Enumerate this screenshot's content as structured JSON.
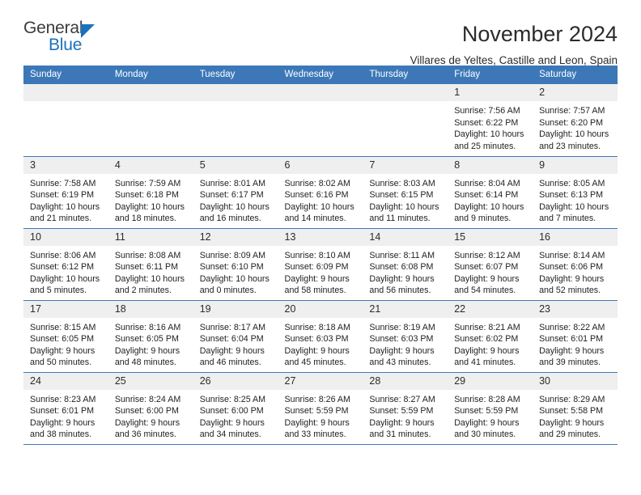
{
  "brand": {
    "name_part1": "General",
    "name_part2": "Blue",
    "triangle_color": "#1a72bd"
  },
  "header": {
    "month_title": "November 2024",
    "location": "Villares de Yeltes, Castille and Leon, Spain"
  },
  "theme": {
    "header_blue": "#3c78b8",
    "daynum_gray": "#efefef"
  },
  "calendar": {
    "weekday_headers": [
      "Sunday",
      "Monday",
      "Tuesday",
      "Wednesday",
      "Thursday",
      "Friday",
      "Saturday"
    ],
    "weeks": [
      [
        {
          "day": "",
          "empty": true
        },
        {
          "day": "",
          "empty": true
        },
        {
          "day": "",
          "empty": true
        },
        {
          "day": "",
          "empty": true
        },
        {
          "day": "",
          "empty": true
        },
        {
          "day": "1",
          "sunrise": "Sunrise: 7:56 AM",
          "sunset": "Sunset: 6:22 PM",
          "daylight1": "Daylight: 10 hours",
          "daylight2": "and 25 minutes."
        },
        {
          "day": "2",
          "sunrise": "Sunrise: 7:57 AM",
          "sunset": "Sunset: 6:20 PM",
          "daylight1": "Daylight: 10 hours",
          "daylight2": "and 23 minutes."
        }
      ],
      [
        {
          "day": "3",
          "sunrise": "Sunrise: 7:58 AM",
          "sunset": "Sunset: 6:19 PM",
          "daylight1": "Daylight: 10 hours",
          "daylight2": "and 21 minutes."
        },
        {
          "day": "4",
          "sunrise": "Sunrise: 7:59 AM",
          "sunset": "Sunset: 6:18 PM",
          "daylight1": "Daylight: 10 hours",
          "daylight2": "and 18 minutes."
        },
        {
          "day": "5",
          "sunrise": "Sunrise: 8:01 AM",
          "sunset": "Sunset: 6:17 PM",
          "daylight1": "Daylight: 10 hours",
          "daylight2": "and 16 minutes."
        },
        {
          "day": "6",
          "sunrise": "Sunrise: 8:02 AM",
          "sunset": "Sunset: 6:16 PM",
          "daylight1": "Daylight: 10 hours",
          "daylight2": "and 14 minutes."
        },
        {
          "day": "7",
          "sunrise": "Sunrise: 8:03 AM",
          "sunset": "Sunset: 6:15 PM",
          "daylight1": "Daylight: 10 hours",
          "daylight2": "and 11 minutes."
        },
        {
          "day": "8",
          "sunrise": "Sunrise: 8:04 AM",
          "sunset": "Sunset: 6:14 PM",
          "daylight1": "Daylight: 10 hours",
          "daylight2": "and 9 minutes."
        },
        {
          "day": "9",
          "sunrise": "Sunrise: 8:05 AM",
          "sunset": "Sunset: 6:13 PM",
          "daylight1": "Daylight: 10 hours",
          "daylight2": "and 7 minutes."
        }
      ],
      [
        {
          "day": "10",
          "sunrise": "Sunrise: 8:06 AM",
          "sunset": "Sunset: 6:12 PM",
          "daylight1": "Daylight: 10 hours",
          "daylight2": "and 5 minutes."
        },
        {
          "day": "11",
          "sunrise": "Sunrise: 8:08 AM",
          "sunset": "Sunset: 6:11 PM",
          "daylight1": "Daylight: 10 hours",
          "daylight2": "and 2 minutes."
        },
        {
          "day": "12",
          "sunrise": "Sunrise: 8:09 AM",
          "sunset": "Sunset: 6:10 PM",
          "daylight1": "Daylight: 10 hours",
          "daylight2": "and 0 minutes."
        },
        {
          "day": "13",
          "sunrise": "Sunrise: 8:10 AM",
          "sunset": "Sunset: 6:09 PM",
          "daylight1": "Daylight: 9 hours",
          "daylight2": "and 58 minutes."
        },
        {
          "day": "14",
          "sunrise": "Sunrise: 8:11 AM",
          "sunset": "Sunset: 6:08 PM",
          "daylight1": "Daylight: 9 hours",
          "daylight2": "and 56 minutes."
        },
        {
          "day": "15",
          "sunrise": "Sunrise: 8:12 AM",
          "sunset": "Sunset: 6:07 PM",
          "daylight1": "Daylight: 9 hours",
          "daylight2": "and 54 minutes."
        },
        {
          "day": "16",
          "sunrise": "Sunrise: 8:14 AM",
          "sunset": "Sunset: 6:06 PM",
          "daylight1": "Daylight: 9 hours",
          "daylight2": "and 52 minutes."
        }
      ],
      [
        {
          "day": "17",
          "sunrise": "Sunrise: 8:15 AM",
          "sunset": "Sunset: 6:05 PM",
          "daylight1": "Daylight: 9 hours",
          "daylight2": "and 50 minutes."
        },
        {
          "day": "18",
          "sunrise": "Sunrise: 8:16 AM",
          "sunset": "Sunset: 6:05 PM",
          "daylight1": "Daylight: 9 hours",
          "daylight2": "and 48 minutes."
        },
        {
          "day": "19",
          "sunrise": "Sunrise: 8:17 AM",
          "sunset": "Sunset: 6:04 PM",
          "daylight1": "Daylight: 9 hours",
          "daylight2": "and 46 minutes."
        },
        {
          "day": "20",
          "sunrise": "Sunrise: 8:18 AM",
          "sunset": "Sunset: 6:03 PM",
          "daylight1": "Daylight: 9 hours",
          "daylight2": "and 45 minutes."
        },
        {
          "day": "21",
          "sunrise": "Sunrise: 8:19 AM",
          "sunset": "Sunset: 6:03 PM",
          "daylight1": "Daylight: 9 hours",
          "daylight2": "and 43 minutes."
        },
        {
          "day": "22",
          "sunrise": "Sunrise: 8:21 AM",
          "sunset": "Sunset: 6:02 PM",
          "daylight1": "Daylight: 9 hours",
          "daylight2": "and 41 minutes."
        },
        {
          "day": "23",
          "sunrise": "Sunrise: 8:22 AM",
          "sunset": "Sunset: 6:01 PM",
          "daylight1": "Daylight: 9 hours",
          "daylight2": "and 39 minutes."
        }
      ],
      [
        {
          "day": "24",
          "sunrise": "Sunrise: 8:23 AM",
          "sunset": "Sunset: 6:01 PM",
          "daylight1": "Daylight: 9 hours",
          "daylight2": "and 38 minutes."
        },
        {
          "day": "25",
          "sunrise": "Sunrise: 8:24 AM",
          "sunset": "Sunset: 6:00 PM",
          "daylight1": "Daylight: 9 hours",
          "daylight2": "and 36 minutes."
        },
        {
          "day": "26",
          "sunrise": "Sunrise: 8:25 AM",
          "sunset": "Sunset: 6:00 PM",
          "daylight1": "Daylight: 9 hours",
          "daylight2": "and 34 minutes."
        },
        {
          "day": "27",
          "sunrise": "Sunrise: 8:26 AM",
          "sunset": "Sunset: 5:59 PM",
          "daylight1": "Daylight: 9 hours",
          "daylight2": "and 33 minutes."
        },
        {
          "day": "28",
          "sunrise": "Sunrise: 8:27 AM",
          "sunset": "Sunset: 5:59 PM",
          "daylight1": "Daylight: 9 hours",
          "daylight2": "and 31 minutes."
        },
        {
          "day": "29",
          "sunrise": "Sunrise: 8:28 AM",
          "sunset": "Sunset: 5:59 PM",
          "daylight1": "Daylight: 9 hours",
          "daylight2": "and 30 minutes."
        },
        {
          "day": "30",
          "sunrise": "Sunrise: 8:29 AM",
          "sunset": "Sunset: 5:58 PM",
          "daylight1": "Daylight: 9 hours",
          "daylight2": "and 29 minutes."
        }
      ]
    ]
  }
}
